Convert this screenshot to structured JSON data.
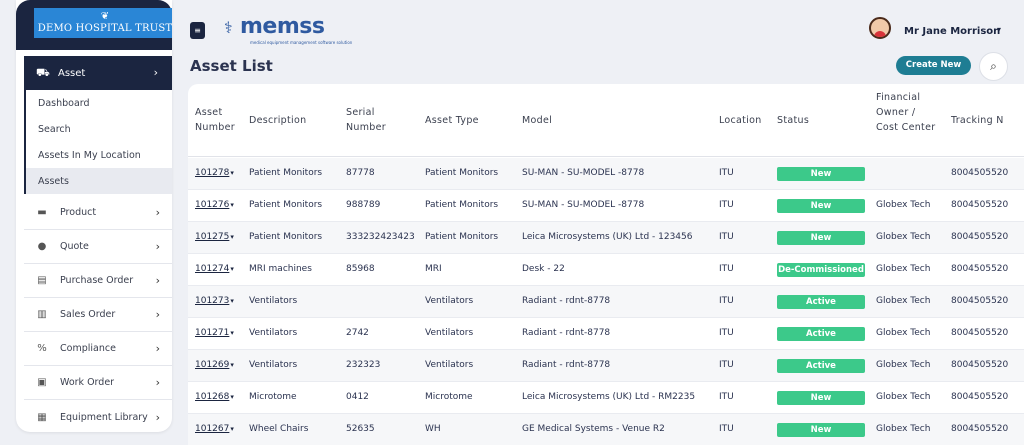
{
  "sidebar": {
    "org_name": "DEMO HOSPITAL TRUST",
    "asset_menu_label": "Asset",
    "submenu": [
      "Dashboard",
      "Search",
      "Assets In My Location",
      "Assets"
    ],
    "menu": [
      {
        "label": "Product",
        "icon": "box-icon"
      },
      {
        "label": "Quote",
        "icon": "quote-icon"
      },
      {
        "label": "Purchase Order",
        "icon": "purchase-order-icon"
      },
      {
        "label": "Sales Order",
        "icon": "sales-order-icon"
      },
      {
        "label": "Compliance",
        "icon": "compliance-icon"
      },
      {
        "label": "Work Order",
        "icon": "work-order-icon"
      },
      {
        "label": "Equipment Library",
        "icon": "library-icon"
      }
    ]
  },
  "header": {
    "brand": "memss",
    "brand_tagline": "medical equipment management software solution",
    "user_name": "Mr Jane Morrison"
  },
  "page": {
    "title": "Asset List",
    "create_label": "Create New"
  },
  "colors": {
    "navy": "#1b2540",
    "teal": "#1e7d93",
    "status_green": "#3cc98a"
  },
  "table": {
    "headers": [
      "Asset Number",
      "Description",
      "Serial Number",
      "Asset Type",
      "Model",
      "Location",
      "Status",
      "Financial Owner / Cost Center",
      "Tracking N"
    ],
    "rows": [
      {
        "asset": "101278",
        "desc": "Patient Monitors",
        "serial": "87778",
        "type": "Patient Monitors",
        "model": "SU-MAN - SU-MODEL -8778",
        "loc": "ITU",
        "status": "New",
        "owner": "",
        "track": "8004505520"
      },
      {
        "asset": "101276",
        "desc": "Patient Monitors",
        "serial": "988789",
        "type": "Patient Monitors",
        "model": "SU-MAN - SU-MODEL -8778",
        "loc": "ITU",
        "status": "New",
        "owner": "Globex Tech",
        "track": "8004505520"
      },
      {
        "asset": "101275",
        "desc": "Patient Monitors",
        "serial": "333232423423",
        "type": "Patient Monitors",
        "model": "Leica Microsystems (UK) Ltd - 123456",
        "loc": "ITU",
        "status": "New",
        "owner": "Globex Tech",
        "track": "8004505520"
      },
      {
        "asset": "101274",
        "desc": "MRI machines",
        "serial": "85968",
        "type": "MRI",
        "model": "Desk - 22",
        "loc": "ITU",
        "status": "De-Commissioned",
        "owner": "Globex Tech",
        "track": "8004505520"
      },
      {
        "asset": "101273",
        "desc": "Ventilators",
        "serial": "",
        "type": "Ventilators",
        "model": "Radiant - rdnt-8778",
        "loc": "ITU",
        "status": "Active",
        "owner": "Globex Tech",
        "track": "8004505520"
      },
      {
        "asset": "101271",
        "desc": "Ventilators",
        "serial": "2742",
        "type": "Ventilators",
        "model": "Radiant - rdnt-8778",
        "loc": "ITU",
        "status": "Active",
        "owner": "Globex Tech",
        "track": "8004505520"
      },
      {
        "asset": "101269",
        "desc": "Ventilators",
        "serial": "232323",
        "type": "Ventilators",
        "model": "Radiant - rdnt-8778",
        "loc": "ITU",
        "status": "Active",
        "owner": "Globex Tech",
        "track": "8004505520"
      },
      {
        "asset": "101268",
        "desc": "Microtome",
        "serial": "0412",
        "type": "Microtome",
        "model": "Leica Microsystems (UK) Ltd - RM2235",
        "loc": "ITU",
        "status": "New",
        "owner": "Globex Tech",
        "track": "8004505520"
      },
      {
        "asset": "101267",
        "desc": "Wheel Chairs",
        "serial": "52635",
        "type": "WH",
        "model": "GE Medical Systems - Venue R2",
        "loc": "ITU",
        "status": "New",
        "owner": "Globex Tech",
        "track": "8004505520"
      }
    ]
  }
}
